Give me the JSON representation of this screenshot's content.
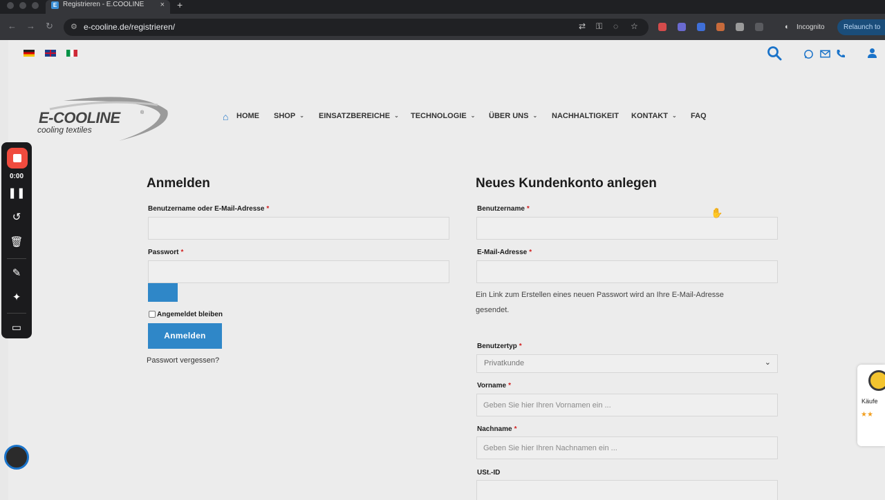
{
  "browser": {
    "tab_title": "Registrieren - E.COOLINE - K",
    "tab_favicon": "E",
    "new_tab": "+",
    "tab_close": "×",
    "url": "e-cooline.de/registrieren/",
    "incognito_label": "Incognito",
    "relaunch_label": "Relaunch to"
  },
  "site": {
    "logo_text": "E-COOLINE",
    "logo_reg": "®",
    "logo_sub": "cooling textiles",
    "nav": [
      {
        "label": "HOME"
      },
      {
        "label": "SHOP",
        "chevron": "⌄"
      },
      {
        "label": "EINSATZBEREICHE",
        "chevron": "⌄"
      },
      {
        "label": "TECHNOLOGIE",
        "chevron": "⌄"
      },
      {
        "label": "ÜBER UNS",
        "chevron": "⌄"
      },
      {
        "label": "NACHHALTIGKEIT"
      },
      {
        "label": "KONTAKT",
        "chevron": "⌄"
      },
      {
        "label": "FAQ"
      }
    ]
  },
  "recorder": {
    "time": "0:00"
  },
  "login": {
    "title": "Anmelden",
    "username_label": "Benutzername oder E-Mail-Adresse",
    "password_label": "Passwort",
    "required_mark": "*",
    "remember_label": "Angemeldet bleiben",
    "submit_label": "Anmelden",
    "lost_password": "Passwort vergessen?"
  },
  "register": {
    "title": "Neues Kundenkonto anlegen",
    "username_label": "Benutzername",
    "email_label": "E-Mail-Adresse",
    "info_text_line1": "Ein Link zum Erstellen eines neuen Passwort wird an Ihre E-Mail-Adresse",
    "info_text_line2": "gesendet.",
    "usertype_label": "Benutzertyp",
    "usertype_value": "Privatkunde",
    "firstname_label": "Vorname",
    "firstname_placeholder": "Geben Sie hier Ihren Vornamen ein ...",
    "lastname_label": "Nachname",
    "lastname_placeholder": "Geben Sie hier Ihren Nachnamen ein ...",
    "vat_label": "USt.-ID"
  },
  "trust_badge": {
    "text": "Käufe",
    "stars": "★★"
  },
  "colors": {
    "accent": "#2f87c8",
    "required": "#d21f1f"
  }
}
